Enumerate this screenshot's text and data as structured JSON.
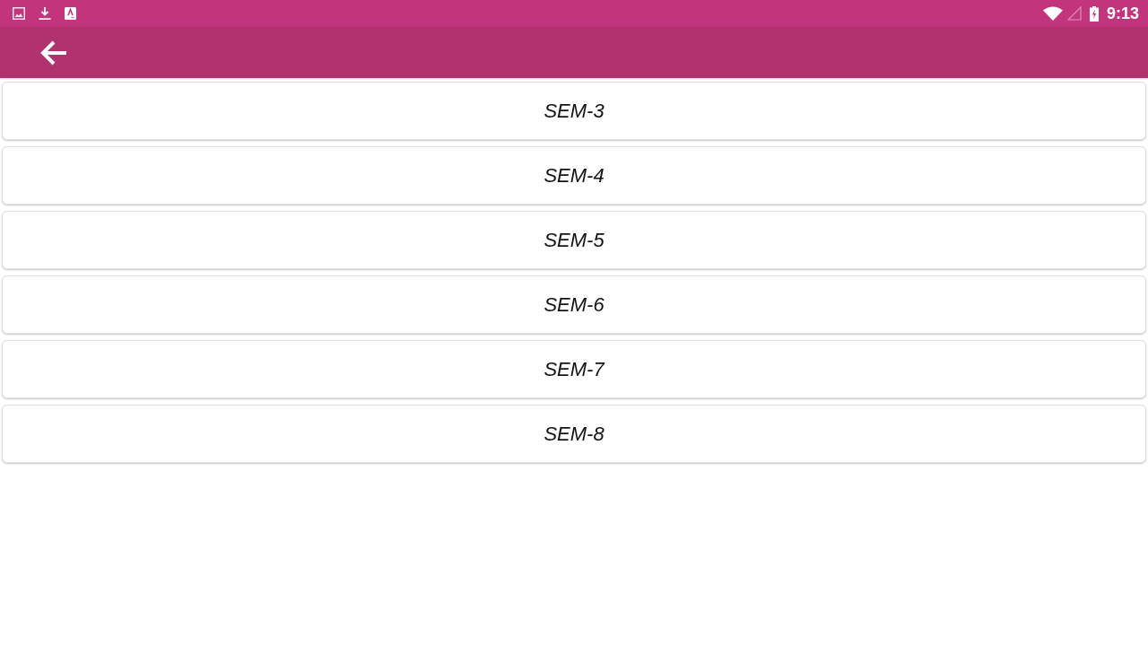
{
  "status_bar": {
    "time": "9:13"
  },
  "semesters": [
    {
      "label": "SEM-3"
    },
    {
      "label": "SEM-4"
    },
    {
      "label": "SEM-5"
    },
    {
      "label": "SEM-6"
    },
    {
      "label": "SEM-7"
    },
    {
      "label": "SEM-8"
    }
  ]
}
